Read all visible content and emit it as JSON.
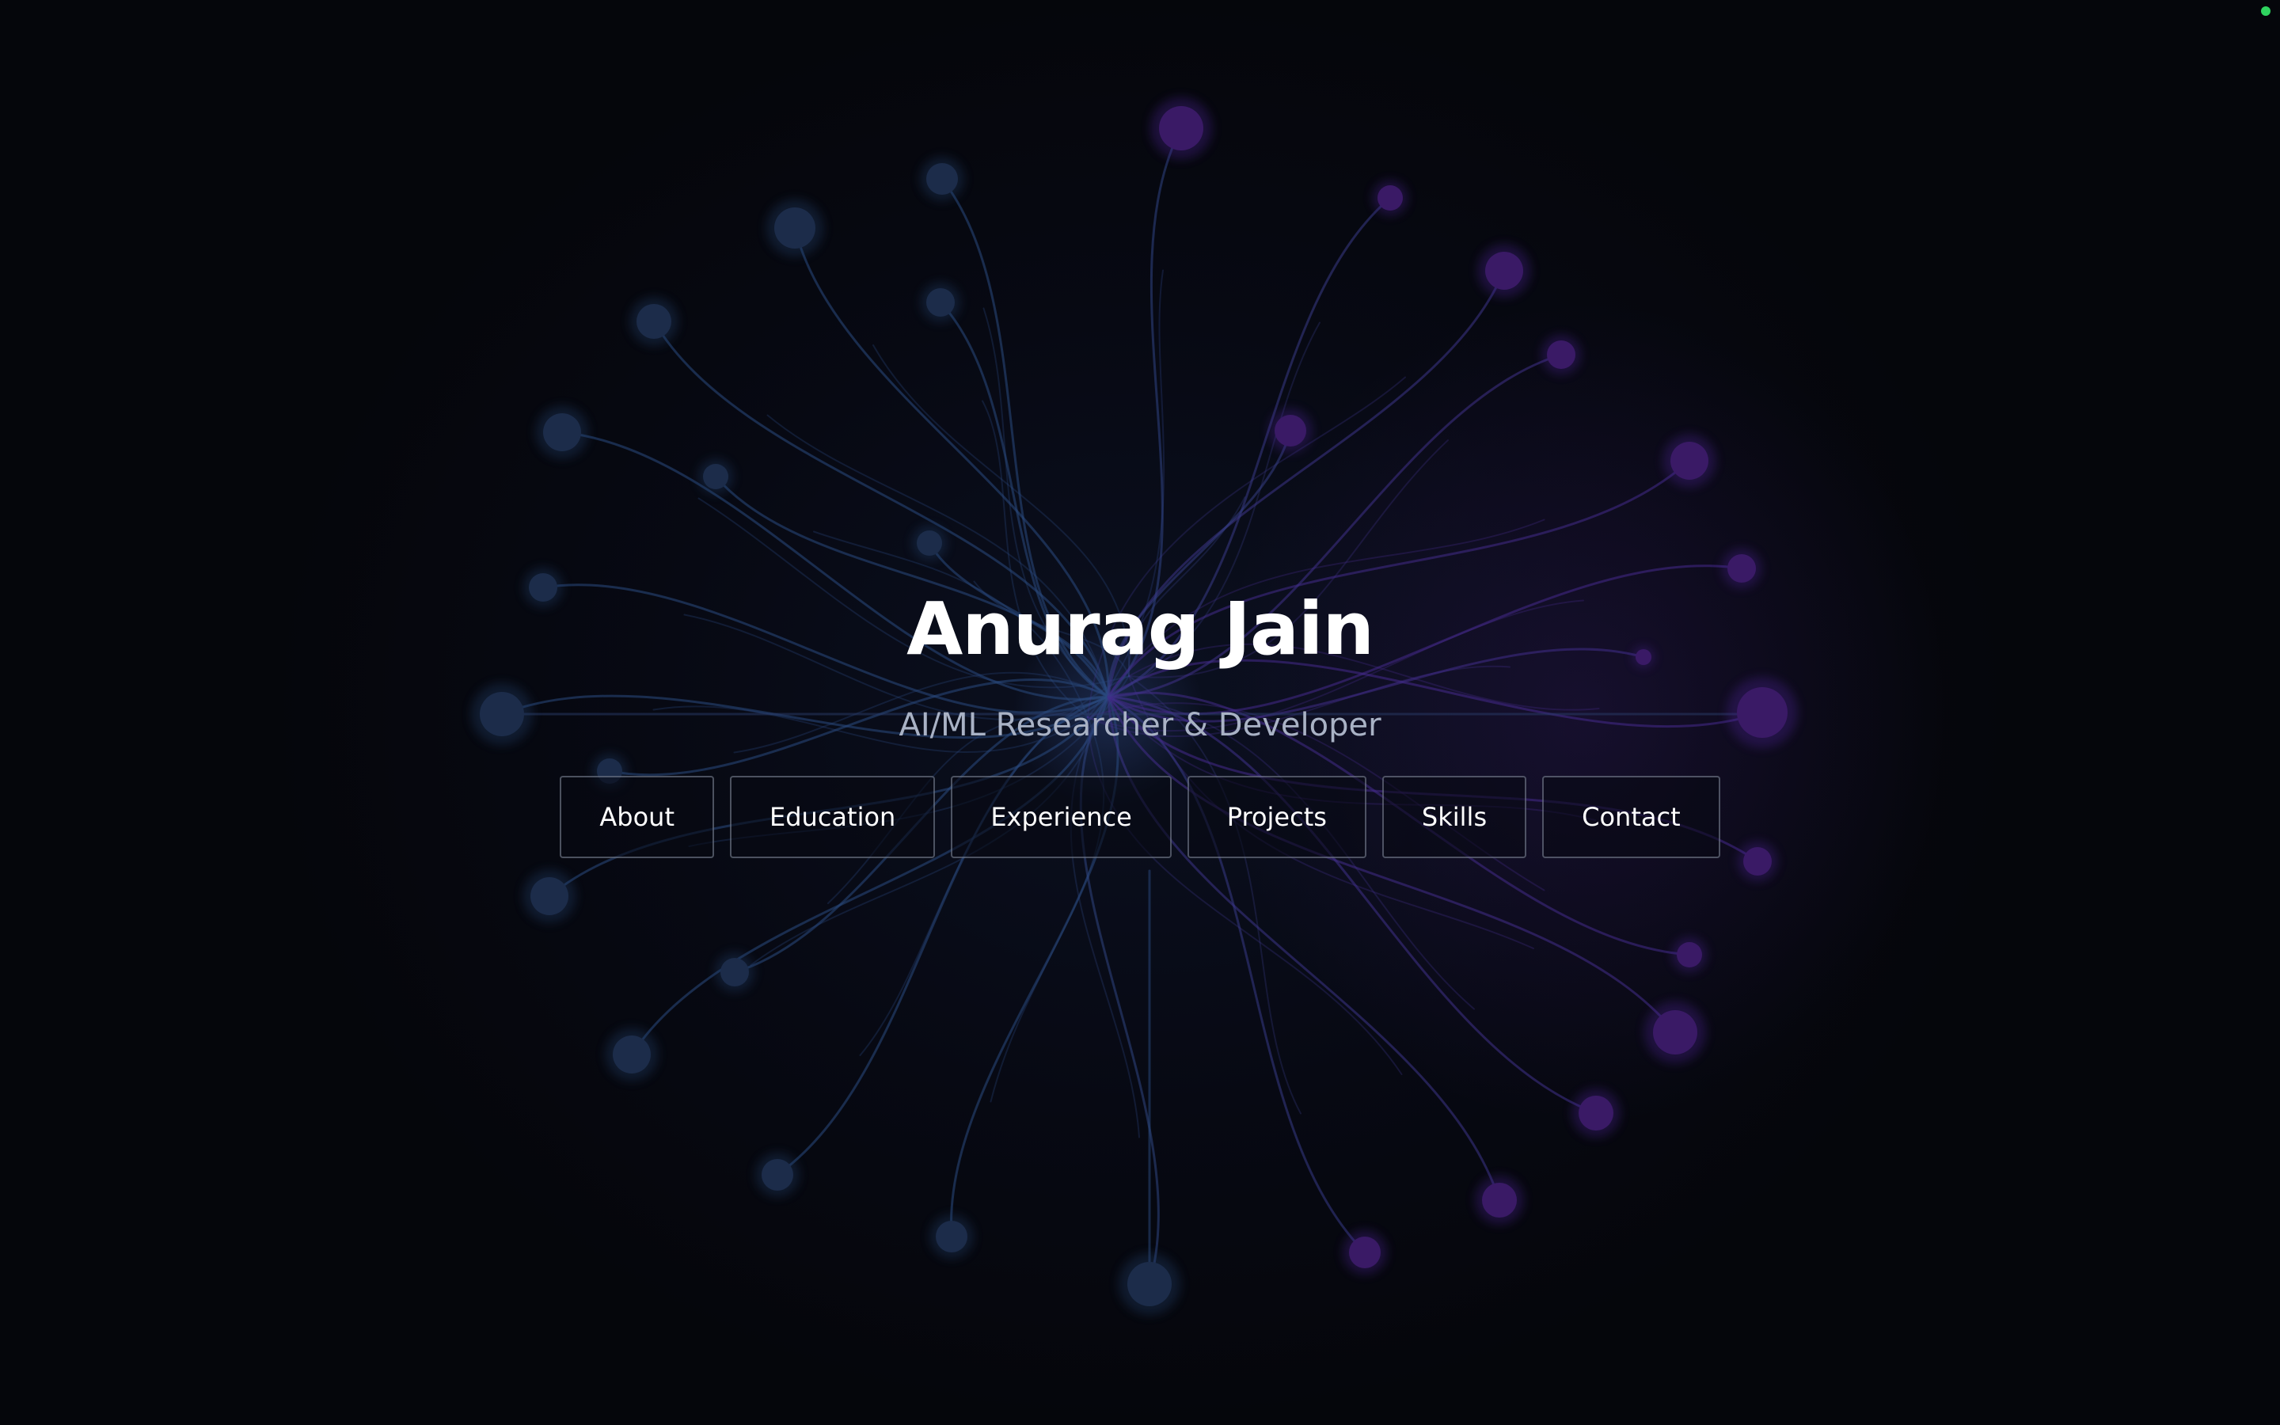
{
  "hero": {
    "title": "Anurag Jain",
    "subtitle": "AI/ML Researcher & Developer"
  },
  "nav": {
    "items": [
      {
        "label": "About"
      },
      {
        "label": "Education"
      },
      {
        "label": "Experience"
      },
      {
        "label": "Projects"
      },
      {
        "label": "Skills"
      },
      {
        "label": "Contact"
      }
    ]
  },
  "theme": {
    "background": "#06070c",
    "line_blue": "#2a4a80",
    "node_blue": "#1c2c4a",
    "line_purple": "#3c2a88",
    "node_purple": "#3a1a66",
    "text_primary": "#ffffff",
    "text_secondary": "#a9b2c5",
    "status_dot": "#2fd35f"
  }
}
